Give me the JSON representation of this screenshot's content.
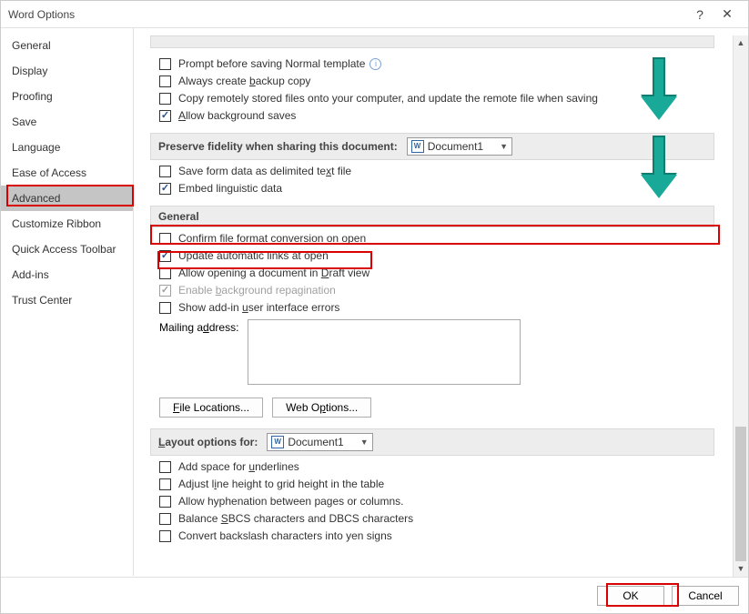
{
  "title": "Word Options",
  "sidebar": {
    "items": [
      {
        "label": "General"
      },
      {
        "label": "Display"
      },
      {
        "label": "Proofing"
      },
      {
        "label": "Save"
      },
      {
        "label": "Language"
      },
      {
        "label": "Ease of Access"
      },
      {
        "label": "Advanced",
        "selected": true
      },
      {
        "label": "Customize Ribbon"
      },
      {
        "label": "Quick Access Toolbar"
      },
      {
        "label": "Add-ins"
      },
      {
        "label": "Trust Center"
      }
    ]
  },
  "save_opts": {
    "prompt_normal": "Prompt before saving Normal template",
    "backup": "Always create backup copy",
    "remote": "Copy remotely stored files onto your computer, and update the remote file when saving",
    "bg_saves": "Allow background saves"
  },
  "fidelity": {
    "head": "Preserve fidelity when sharing this document:",
    "doc": "Document1",
    "delim": "Save form data as delimited text file",
    "embed": "Embed linguistic data"
  },
  "general": {
    "head": "General",
    "confirm": "Confirm file format conversion on open",
    "update_links": "Update automatic links at open",
    "draft": "Allow opening a document in Draft view",
    "repag": "Enable background repagination",
    "addin_err": "Show add-in user interface errors",
    "mailing": "Mailing address:",
    "file_loc": "File Locations...",
    "web_opt": "Web Options..."
  },
  "layout": {
    "head": "Layout options for:",
    "doc": "Document1",
    "underlines": "Add space for underlines",
    "line_height": "Adjust line height to grid height in the table",
    "hyphen": "Allow hyphenation between pages or columns.",
    "sbcs": "Balance SBCS characters and DBCS characters",
    "yen": "Convert backslash characters into yen signs"
  },
  "footer": {
    "ok": "OK",
    "cancel": "Cancel"
  }
}
